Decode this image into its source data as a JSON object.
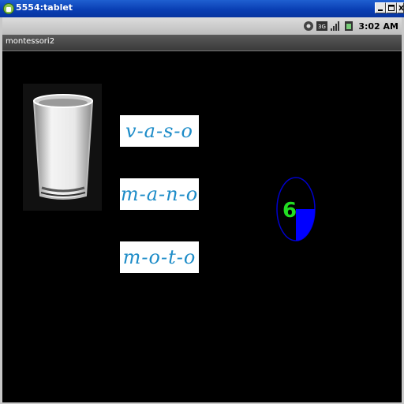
{
  "window": {
    "title": "5554:tablet"
  },
  "statusbar": {
    "time": "3:02 AM"
  },
  "app": {
    "title": "montessori2"
  },
  "words": [
    {
      "text": "v-a-s-o"
    },
    {
      "text": "m-a-n-o"
    },
    {
      "text": "m-o-t-o"
    }
  ],
  "timer": {
    "value": "6",
    "remaining_fraction": 0.75,
    "digit_color": "#22dd22",
    "fill_color": "#0000ff"
  },
  "colors": {
    "titlebar": "#0a3fb4",
    "word_ink": "#1d8cc8"
  }
}
